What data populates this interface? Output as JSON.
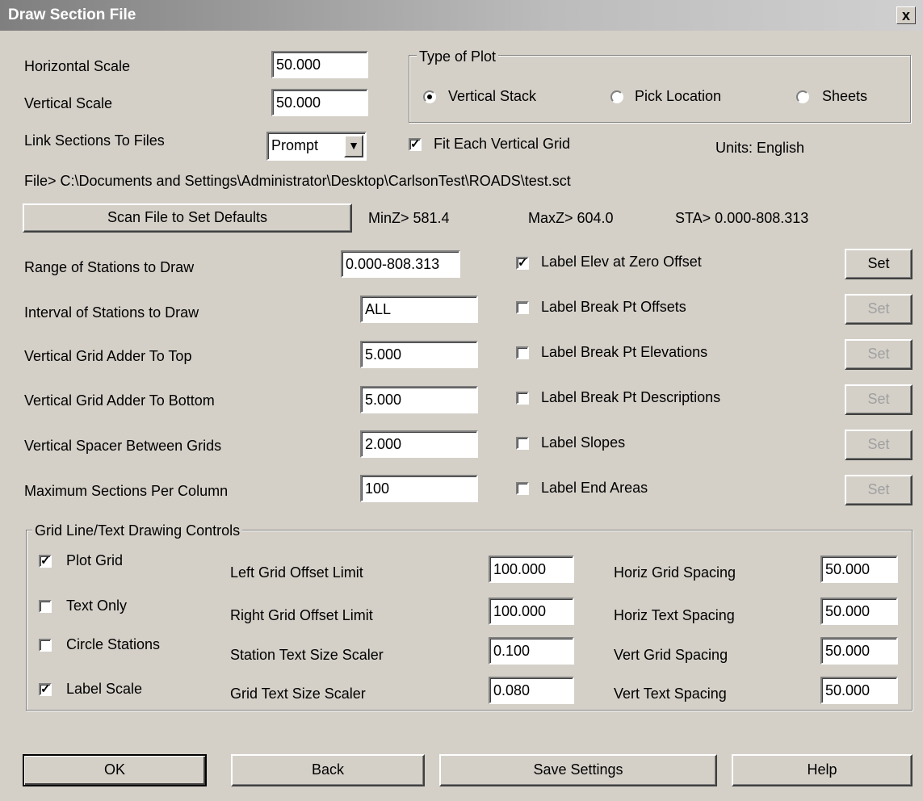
{
  "window": {
    "title": "Draw Section File",
    "close_label": "x"
  },
  "scales": {
    "horizontal_label": "Horizontal Scale",
    "horizontal_value": "50.000",
    "vertical_label": "Vertical Scale",
    "vertical_value": "50.000",
    "link_label": "Link Sections To Files",
    "link_value": "Prompt"
  },
  "plot_type": {
    "legend": "Type of Plot",
    "options": [
      {
        "label": "Vertical Stack",
        "selected": true
      },
      {
        "label": "Pick Location",
        "selected": false
      },
      {
        "label": "Sheets",
        "selected": false
      }
    ]
  },
  "fit_grid": {
    "label": "Fit Each Vertical Grid",
    "checked": true
  },
  "units": "Units: English",
  "file_path": "File> C:\\Documents and Settings\\Administrator\\Desktop\\CarlsonTest\\ROADS\\test.sct",
  "scan": {
    "button": "Scan File to Set Defaults",
    "minz": "MinZ> 581.4",
    "maxz": "MaxZ> 604.0",
    "sta": "STA> 0.000-808.313"
  },
  "stations": [
    {
      "label": "Range of Stations to Draw",
      "value": "0.000-808.313"
    },
    {
      "label": "Interval of Stations to Draw",
      "value": "ALL"
    },
    {
      "label": "Vertical Grid Adder To Top",
      "value": "5.000"
    },
    {
      "label": "Vertical Grid Adder To Bottom",
      "value": "5.000"
    },
    {
      "label": "Vertical Spacer Between Grids",
      "value": "2.000"
    },
    {
      "label": "Maximum Sections Per Column",
      "value": "100"
    }
  ],
  "label_options": [
    {
      "label": "Label Elev at Zero Offset",
      "checked": true,
      "set": "Set"
    },
    {
      "label": "Label Break Pt Offsets",
      "checked": false,
      "set": "Set"
    },
    {
      "label": "Label Break Pt Elevations",
      "checked": false,
      "set": "Set"
    },
    {
      "label": "Label Break Pt Descriptions",
      "checked": false,
      "set": "Set"
    },
    {
      "label": "Label Slopes",
      "checked": false,
      "set": "Set"
    },
    {
      "label": "Label End Areas",
      "checked": false,
      "set": "Set"
    }
  ],
  "grid": {
    "legend": "Grid Line/Text Drawing Controls",
    "checks": [
      {
        "label": "Plot Grid",
        "checked": true
      },
      {
        "label": "Text Only",
        "checked": false
      },
      {
        "label": "Circle Stations",
        "checked": false
      },
      {
        "label": "Label Scale",
        "checked": true
      }
    ],
    "middle": [
      {
        "label": "Left Grid Offset Limit",
        "value": "100.000"
      },
      {
        "label": "Right Grid Offset Limit",
        "value": "100.000"
      },
      {
        "label": "Station Text Size Scaler",
        "value": "0.100"
      },
      {
        "label": "Grid Text Size Scaler",
        "value": "0.080"
      }
    ],
    "right": [
      {
        "label": "Horiz Grid Spacing",
        "value": "50.000"
      },
      {
        "label": "Horiz Text Spacing",
        "value": "50.000"
      },
      {
        "label": "Vert Grid Spacing",
        "value": "50.000"
      },
      {
        "label": "Vert Text Spacing",
        "value": "50.000"
      }
    ]
  },
  "footer": {
    "ok": "OK",
    "back": "Back",
    "save": "Save Settings",
    "help": "Help"
  }
}
